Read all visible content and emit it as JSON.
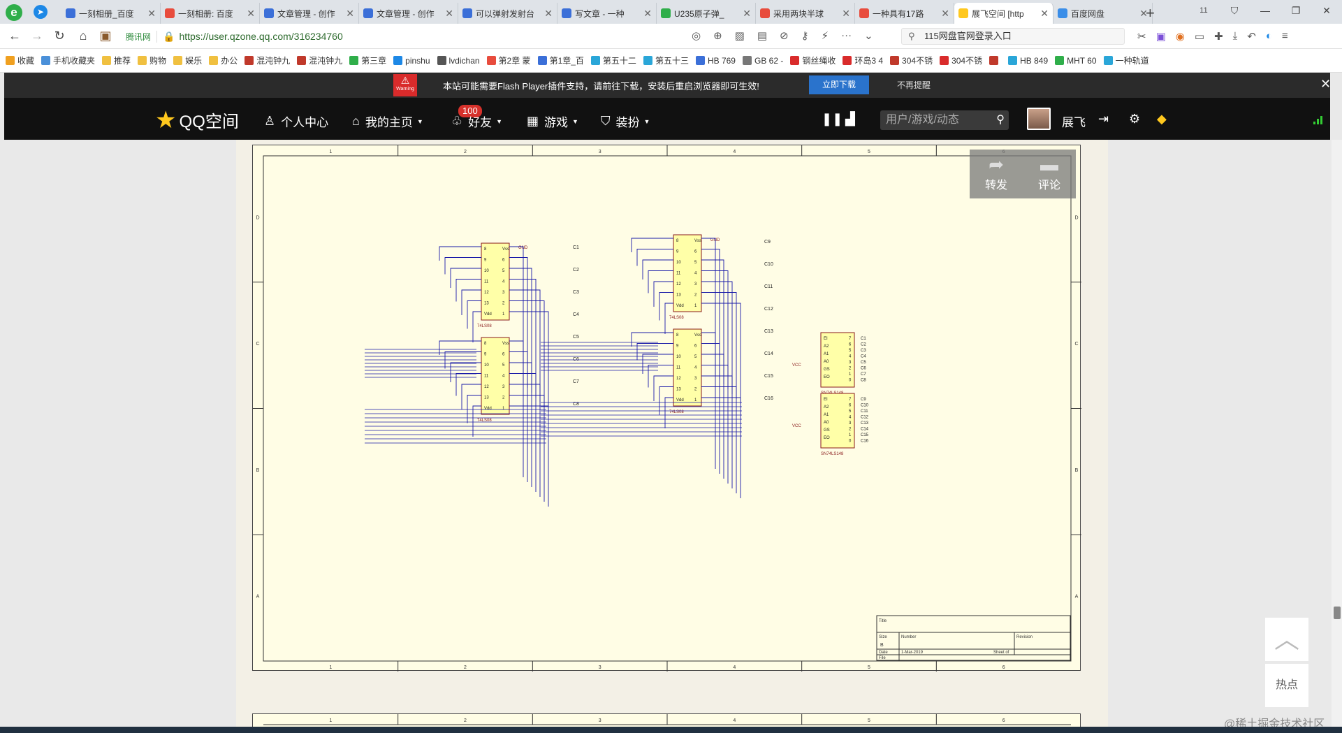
{
  "tabs": [
    {
      "title": "一刻相册_百度",
      "color": "#3b6fd8",
      "active": false
    },
    {
      "title": "一刻相册: 百度",
      "color": "#e84c3d",
      "active": false
    },
    {
      "title": "文章管理 - 创作",
      "color": "#3b6fd8",
      "active": false
    },
    {
      "title": "文章管理 - 创作",
      "color": "#3b6fd8",
      "active": false
    },
    {
      "title": "可以弹射发射台",
      "color": "#3b6fd8",
      "active": false
    },
    {
      "title": "写文章 - 一种",
      "color": "#3b6fd8",
      "active": false
    },
    {
      "title": "U235原子弹_",
      "color": "#2fae4a",
      "active": false
    },
    {
      "title": "采用两块半球",
      "color": "#e84c3d",
      "active": false
    },
    {
      "title": "一种具有17路",
      "color": "#e84c3d",
      "active": false
    },
    {
      "title": "展飞空间 [http",
      "color": "#ffc81e",
      "active": true
    },
    {
      "title": "百度网盘",
      "color": "#3b8ee8",
      "active": false
    }
  ],
  "browser": {
    "tab_count": "11",
    "site_label": "腾讯网",
    "url": "https://user.qzone.qq.com/316234760",
    "search_text": "115网盘官网登录入口"
  },
  "bookmarks": [
    {
      "label": "收藏",
      "color": "#f0a020"
    },
    {
      "label": "手机收藏夹",
      "color": "#4a90d9"
    },
    {
      "label": "推荐",
      "color": "#f0c040"
    },
    {
      "label": "购物",
      "color": "#f0c040"
    },
    {
      "label": "娱乐",
      "color": "#f0c040"
    },
    {
      "label": "办公",
      "color": "#f0c040"
    },
    {
      "label": "混沌钟九",
      "color": "#c0392b"
    },
    {
      "label": "混沌钟九",
      "color": "#c0392b"
    },
    {
      "label": "第三章",
      "color": "#2fae4a"
    },
    {
      "label": "pinshu",
      "color": "#1d88e6"
    },
    {
      "label": "lvdichan",
      "color": "#555555"
    },
    {
      "label": "第2章 蒙",
      "color": "#e84c3d"
    },
    {
      "label": "第1章_百",
      "color": "#3b6fd8"
    },
    {
      "label": "第五十二",
      "color": "#2aa6d8"
    },
    {
      "label": "第五十三",
      "color": "#2aa6d8"
    },
    {
      "label": "HB 769",
      "color": "#3b6fd8"
    },
    {
      "label": "GB 62 -",
      "color": "#777777"
    },
    {
      "label": "钢丝绳收",
      "color": "#d92b2b"
    },
    {
      "label": "环岛3 4",
      "color": "#d92b2b"
    },
    {
      "label": "304不锈",
      "color": "#c0392b"
    },
    {
      "label": "304不锈",
      "color": "#d92b2b"
    },
    {
      "label": "",
      "color": "#c0392b"
    },
    {
      "label": "HB 849",
      "color": "#2aa6d8"
    },
    {
      "label": "MHT 60",
      "color": "#2fae4a"
    },
    {
      "label": "一种轨道",
      "color": "#2aa6d8"
    }
  ],
  "flash": {
    "warning_small": "Warning",
    "message": "本站可能需要Flash Player插件支持，请前往下载，安装后重启浏览器即可生效!",
    "download_label": "立即下载",
    "dismiss_label": "不再提醒"
  },
  "qqnav": {
    "logo": "QQ空间",
    "personal_center": "个人中心",
    "my_home": "我的主页",
    "friends": "好友",
    "friends_badge": "100",
    "games": "游戏",
    "dressup": "装扮",
    "search_placeholder": "用户/游戏/动态",
    "username": "展飞"
  },
  "share": {
    "forward": "转发",
    "comment": "评论"
  },
  "side": {
    "hot": "热点",
    "watermark": "@稀土掘金技术社区"
  },
  "schematic": {
    "top_labels": [
      "1",
      "2",
      "3",
      "4",
      "5",
      "6"
    ],
    "side_labels": [
      "D",
      "C",
      "B",
      "A"
    ],
    "title_block": {
      "title": "Title",
      "size": "Size",
      "size_val": "B",
      "number": "Number",
      "revision": "Revision",
      "date": "Date",
      "date_val": "1-Mar-2019",
      "file": "File",
      "sheet": "Sheet of"
    },
    "chips": [
      "74LS08",
      "74LS08",
      "74LS08",
      "74LS08",
      "SN74LS148",
      "SN74LS148"
    ],
    "pins_left": [
      "8",
      "9",
      "10",
      "11",
      "12",
      "13",
      "Vdd"
    ],
    "pins_right": [
      "Vss",
      "6",
      "5",
      "4",
      "3",
      "2",
      "1"
    ],
    "enc_pins_left": [
      "EI",
      "A2",
      "A1",
      "A0",
      "GS",
      "EO"
    ],
    "enc_pins_right": [
      "7",
      "6",
      "5",
      "4",
      "3",
      "2",
      "1",
      "0"
    ],
    "outputs_a": [
      "C1",
      "C2",
      "C3",
      "C4",
      "C5",
      "C6",
      "C7",
      "C8"
    ],
    "outputs_b": [
      "C9",
      "C10",
      "C11",
      "C12",
      "C13",
      "C14",
      "C15",
      "C16"
    ],
    "gnd": "GND",
    "vcc": "VCC"
  }
}
